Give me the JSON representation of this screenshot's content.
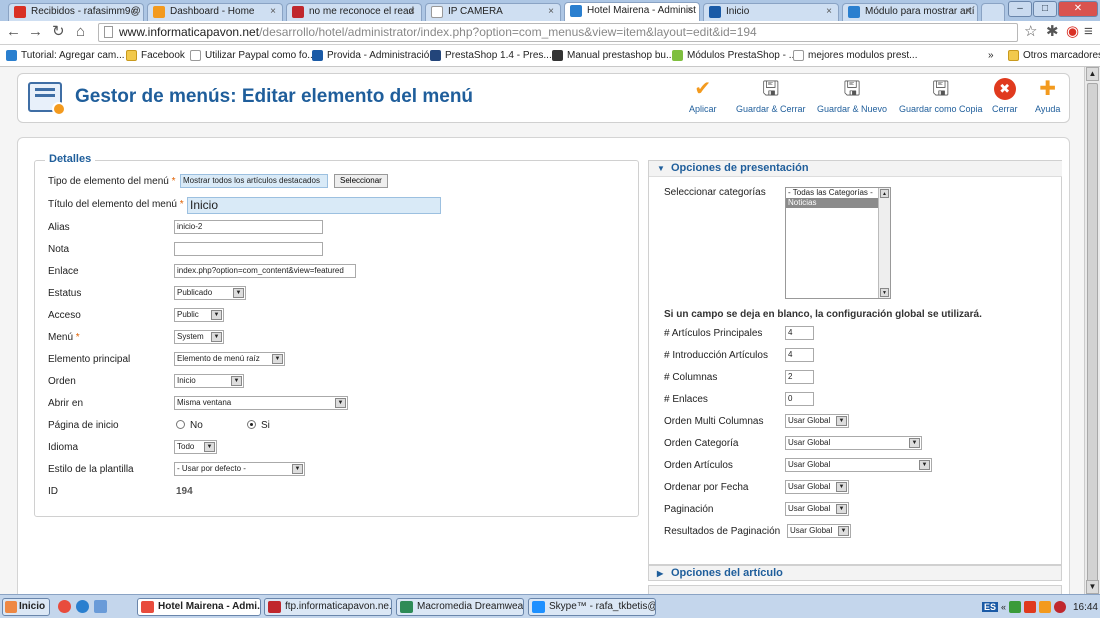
{
  "browser": {
    "tabs": [
      {
        "label": "Recibidos - rafasimm9@",
        "color": "#d93025"
      },
      {
        "label": "Dashboard - Home",
        "color": "#f39a1e"
      },
      {
        "label": "no me reconoce el read",
        "color": "#c0272d"
      },
      {
        "label": "IP CAMERA",
        "color": "#cccccc"
      },
      {
        "label": "Hotel Mairena - Administ",
        "color": "#2a7fcf"
      },
      {
        "label": "Inicio",
        "color": "#1a5aa6"
      },
      {
        "label": "Módulo para mostrar artí",
        "color": "#2a7fcf"
      }
    ],
    "url_domain": "www.informaticapavon.net",
    "url_rest": "/desarrollo/hotel/administrator/index.php?option=com_menus&view=item&layout=edit&id=194",
    "bookmarks": [
      {
        "label": "Tutorial: Agregar cam...",
        "icon": "joomla-icon"
      },
      {
        "label": "Facebook",
        "icon": "folder-icon"
      },
      {
        "label": "Utilizar Paypal como fo...",
        "icon": "page-icon"
      },
      {
        "label": "Provida - Administración",
        "icon": "provida-icon"
      },
      {
        "label": "PrestaShop 1.4 - Pres...",
        "icon": "prestashop-icon"
      },
      {
        "label": "Manual prestashop bu...",
        "icon": "manual-icon"
      },
      {
        "label": "Módulos PrestaShop - ...",
        "icon": "module-icon"
      },
      {
        "label": "mejores modulos prest...",
        "icon": "page-icon"
      }
    ],
    "bookmarks_more": "»",
    "other_bookmarks": "Otros marcadores"
  },
  "header": {
    "title": "Gestor de menús: Editar elemento del menú",
    "buttons": [
      {
        "label": "Aplicar",
        "icon": "check-icon",
        "glyph": "✔",
        "color": "#f39a1e"
      },
      {
        "label": "Guardar & Cerrar",
        "icon": "save-close-icon",
        "glyph": "🖫",
        "color": "#555555"
      },
      {
        "label": "Guardar & Nuevo",
        "icon": "save-new-icon",
        "glyph": "🖫",
        "color": "#555555"
      },
      {
        "label": "Guardar como Copia",
        "icon": "save-copy-icon",
        "glyph": "🖫",
        "color": "#555555"
      },
      {
        "label": "Cerrar",
        "icon": "close-icon",
        "glyph": "✖",
        "color": "#e03a1e"
      },
      {
        "label": "Ayuda",
        "icon": "help-icon",
        "glyph": "✚",
        "color": "#f39a1e"
      }
    ]
  },
  "details": {
    "legend": "Detalles",
    "tipo_label": "Tipo de elemento del menú",
    "tipo_value": "Mostrar todos los artículos destacados",
    "tipo_button": "Seleccionar",
    "titulo_label": "Título del elemento del menú",
    "titulo_value": "Inicio",
    "alias_label": "Alias",
    "alias_value": "inicio-2",
    "nota_label": "Nota",
    "nota_value": "",
    "enlace_label": "Enlace",
    "enlace_value": "index.php?option=com_content&view=featured",
    "estatus_label": "Estatus",
    "estatus_value": "Publicado",
    "acceso_label": "Acceso",
    "acceso_value": "Public",
    "menu_label": "Menú",
    "menu_value": "System",
    "principal_label": "Elemento principal",
    "principal_value": "Elemento de menú raíz",
    "orden_label": "Orden",
    "orden_value": "Inicio",
    "abrir_label": "Abrir en",
    "abrir_value": "Misma ventana",
    "pagina_label": "Página de inicio",
    "no_label": "No",
    "si_label": "Si",
    "idioma_label": "Idioma",
    "idioma_value": "Todo",
    "estilo_label": "Estilo de la plantilla",
    "estilo_value": "- Usar por defecto -",
    "id_label": "ID",
    "id_value": "194",
    "required_mark": "*"
  },
  "options": {
    "presentacion": "Opciones de presentación",
    "categorias_label": "Seleccionar categorías",
    "categorias_items": [
      "- Todas las Categorías -",
      "Noticias"
    ],
    "notice": "Si un campo se deja en blanco, la configuración global se utilizará.",
    "principales_label": "# Artículos Principales",
    "principales_value": "4",
    "introduccion_label": "# Introducción Artículos",
    "introduccion_value": "4",
    "columnas_label": "# Columnas",
    "columnas_value": "2",
    "enlaces_label": "# Enlaces",
    "enlaces_value": "0",
    "multi_label": "Orden Multi Columnas",
    "multi_value": "Usar Global",
    "categoria_label": "Orden Categoría",
    "categoria_value": "Usar Global",
    "articulos_label": "Orden Artículos",
    "articulos_value": "Usar Global",
    "fecha_label": "Ordenar por Fecha",
    "fecha_value": "Usar Global",
    "paginacion_label": "Paginación",
    "paginacion_value": "Usar Global",
    "resultados_label": "Resultados de Paginación",
    "resultados_value": "Usar Global",
    "articulo_section": "Opciones del artículo"
  },
  "taskbar": {
    "start": "Inicio",
    "tasks": [
      {
        "label": "Hotel Mairena - Admi...",
        "color": "#2a7fcf"
      },
      {
        "label": "ftp.informaticapavon.ne...",
        "color": "#c0272d"
      },
      {
        "label": "Macromedia Dreamweav...",
        "color": "#2e8b57"
      },
      {
        "label": "Skype™ - rafa_tkbetis@...",
        "color": "#1e90ff"
      }
    ],
    "lang": "ES",
    "time": "16:44"
  }
}
